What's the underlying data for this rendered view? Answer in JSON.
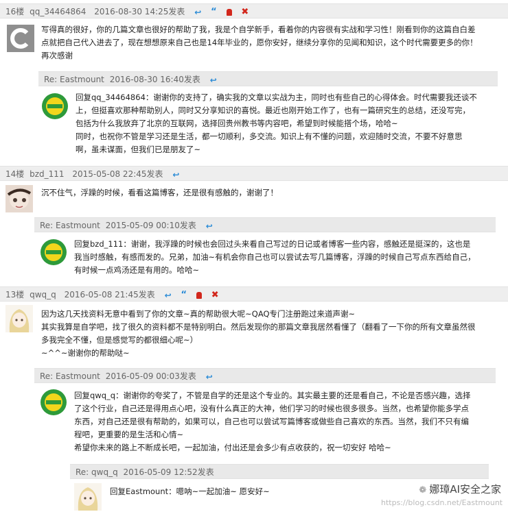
{
  "comments": [
    {
      "floor": "16楼",
      "user": "qq_34464864",
      "date": "2016-08-30 14:25",
      "post_label": "发表",
      "actions": [
        "reply",
        "quote",
        "report",
        "delete"
      ],
      "lines": [
        "写得真的很好，你的几篇文章也很好的帮助了我，我是个自学新手，看着你的内容很有实战和学习性！刚看到你的这篇自白差",
        "点就把自己代入进去了，现在想想原来自己也是14年毕业的，愿你安好，继续分享你的见闻和知识，这个时代需要更多的你！",
        "再次感谢"
      ],
      "reply": {
        "header": "Re: Eastmount",
        "date": "2016-08-30 16:40",
        "post_label": "发表",
        "lines": [
          "回复qq_34464864：谢谢你的支持了，确实我的文章以实战为主，同时也有些自己的心得体会。时代需要我还谈不",
          "上，但挺喜欢那种帮助别人，同时又分享知识的喜悦。最近也刚开始工作了，也有一篇研究生的总结，还没写完，",
          "包括为什么我放弃了北京的互联网，选择回贵州教书等内容吧，希望到时候能搭个场，哈哈~",
          "同时，也祝你不管是学习还是生活，都一切顺利，多交流。知识上有不懂的问题，欢迎随时交流，不要不好意思",
          "啊，虽未谋面，但我们已是朋友了~"
        ]
      }
    },
    {
      "floor": "14楼",
      "user": "bzd_111",
      "date": "2015-05-08 22:45",
      "post_label": "发表",
      "actions": [
        "reply"
      ],
      "lines": [
        "沉不住气，浮躁的时候，看看这篇博客，还是很有感触的，谢谢了！"
      ],
      "reply": {
        "header": "Re: Eastmount",
        "date": "2015-05-09 00:10",
        "post_label": "发表",
        "lines": [
          "回复bzd_111：谢谢，我浮躁的时候也会回过头来看自己写过的日记或者博客一些内容，感触还是挺深的，这也是",
          "我当时感触，有感而发的。兄弟，加油~有机会你自己也可以尝试去写几篇博客，浮躁的时候自己写点东西给自己，",
          "有时候一点鸡汤还是有用的。哈哈~"
        ]
      }
    },
    {
      "floor": "13楼",
      "user": "qwq_q",
      "date": "2016-05-08 21:45",
      "post_label": "发表",
      "actions": [
        "reply",
        "quote",
        "report",
        "delete"
      ],
      "lines": [
        "因为这几天找资料无意中看到了你的文章~真的帮助很大呢~QAQ专门注册跑过来道声谢~",
        "其实我算是自学吧，找了很久的资料都不是特别明白。然后发现你的那篇文章我居然看懂了（翻看了一下你的所有文章虽然很",
        "多我完全不懂，但是感觉写的都很细心呢~）",
        "~^^~谢谢你的帮助哒~"
      ],
      "reply": {
        "header": "Re: Eastmount",
        "date": "2016-05-09 00:03",
        "post_label": "发表",
        "lines": [
          "回复qwq_q：谢谢你的夸奖了，不管是自学的还是这个专业的。其实最主要的还是看自己，不论是否感兴趣，选择",
          "了这个行业，自己还是得用点心吧，没有什么真正的大神，他们学习的时候也很多很多。当然，也希望你能多学点",
          "东西，对自己还是很有帮助的，如果可以，自己也可以尝试写篇博客或做些自己喜欢的东西。当然，我们不只有编",
          "程吧，更重要的是生活和心情~",
          "希望你未来的路上不断成长吧，一起加油，付出还是会多少有点收获的，祝一切安好 哈哈~"
        ],
        "nested": {
          "header": "Re: qwq_q",
          "date": "2016-05-09 12:52",
          "post_label": "发表",
          "lines": [
            "回复Eastmount：嗯呐~一起加油~ 愿安好~"
          ]
        }
      }
    }
  ],
  "watermark": {
    "brand": "娜璋AI安全之家",
    "url": "https://blog.csdn.net/Eastmount"
  },
  "colors": {
    "header_bg": "#eeeeee",
    "reply_header_bg": "#e9e9e9",
    "action_blue": "#2a8bd6",
    "action_red": "#d2271c",
    "avatar_green": "#2e9a3a",
    "avatar_yellow": "#f2d61c"
  }
}
